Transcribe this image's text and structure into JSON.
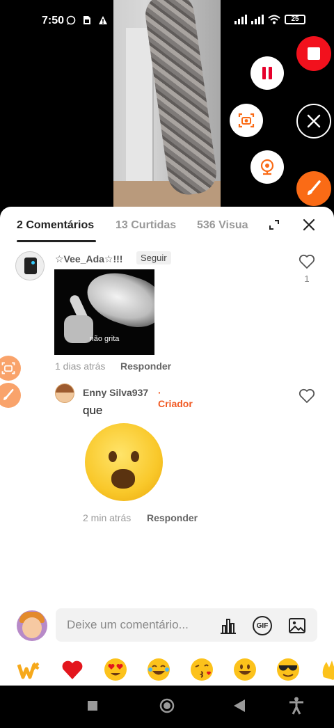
{
  "status_bar": {
    "time": "7:50",
    "battery": "25"
  },
  "recorder": {
    "stop_icon": "stop-square-icon",
    "pause_icon": "pause-icon",
    "screenshot_icon": "camera-icon",
    "close_icon": "close-icon",
    "webcam_icon": "webcam-icon",
    "brush_icon": "brush-icon",
    "accent_color": "#fa6b16",
    "stop_color": "#f2111d"
  },
  "tabs": [
    {
      "label": "2 Comentários",
      "active": true
    },
    {
      "label": "13 Curtidas",
      "active": false
    },
    {
      "label": "536 Visua",
      "active": false
    }
  ],
  "comments": [
    {
      "username": "☆Vee_Ada☆!!!",
      "follow_label": "Seguir",
      "image_caption": "não grita",
      "time": "1 dias atrás",
      "reply_label": "Responder",
      "likes": "1"
    }
  ],
  "replies": [
    {
      "username": "Enny Silva937",
      "tag": "Criador",
      "text": "que",
      "time": "2 min atrás",
      "reply_label": "Responder"
    }
  ],
  "comment_input": {
    "placeholder": "Deixe um comentário..."
  },
  "input_icons": [
    "poll-icon",
    "gif-icon",
    "image-icon"
  ],
  "gif_label": "GIF",
  "emoji_row": [
    "wow-sticker",
    "heart",
    "heart-eyes",
    "joy",
    "kiss",
    "smile",
    "sunglasses",
    "clap"
  ],
  "navbar": {
    "icons": [
      "recents-square-icon",
      "home-circle-icon",
      "back-triangle-icon",
      "accessibility-icon"
    ]
  }
}
